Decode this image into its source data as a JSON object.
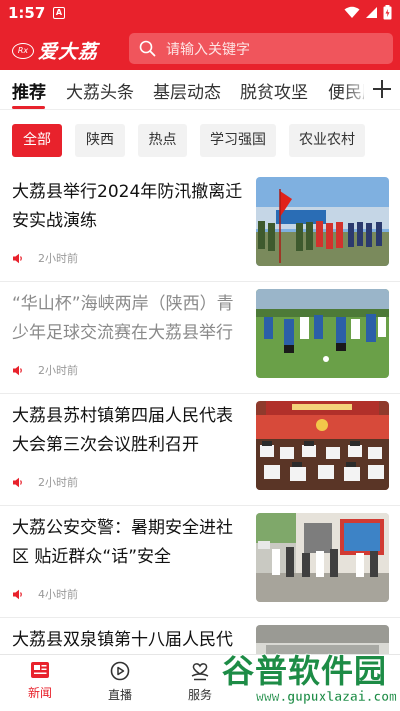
{
  "status_bar": {
    "time": "1:57",
    "notification_badge": "A"
  },
  "header": {
    "logo_mark": "Rx",
    "app_name": "爱大荔",
    "search_placeholder": "请输入关键字"
  },
  "tabs": [
    "推荐",
    "大荔头条",
    "基层动态",
    "脱贫攻坚",
    "便民服务"
  ],
  "active_tab_index": 0,
  "chips": [
    "全部",
    "陕西",
    "热点",
    "学习强国",
    "农业农村"
  ],
  "active_chip_index": 0,
  "news": [
    {
      "title": "大荔县举行2024年防汛撤离迁安实战演练",
      "time_ago": "2小时前",
      "read": false,
      "thumb": "flood-drill-photo"
    },
    {
      "title": "“华山杯”海峡两岸（陕西）青少年足球交流赛在大荔县举行",
      "time_ago": "2小时前",
      "read": true,
      "thumb": "football-photo"
    },
    {
      "title": "大荔县苏村镇第四届人民代表大会第三次会议胜利召开",
      "time_ago": "2小时前",
      "read": false,
      "thumb": "meeting-hall-photo"
    },
    {
      "title": "大荔公安交警：暑期安全进社区 贴近群众“话”安全",
      "time_ago": "4小时前",
      "read": false,
      "thumb": "community-photo"
    },
    {
      "title": "大荔县双泉镇第十八届人民代表大会",
      "time_ago": "",
      "read": false,
      "thumb": "meeting-photo"
    }
  ],
  "bottom_nav": [
    {
      "label": "新闻",
      "icon": "news-icon"
    },
    {
      "label": "直播",
      "icon": "live-icon"
    },
    {
      "label": "服务",
      "icon": "service-icon"
    }
  ],
  "active_nav_index": 0,
  "watermark": {
    "text": "谷普软件园",
    "url": "www.gupuxlazai.com"
  },
  "colors": {
    "brand_red": "#e8222c",
    "search_bg": "#f0555c",
    "watermark_green": "#1d8c46"
  }
}
